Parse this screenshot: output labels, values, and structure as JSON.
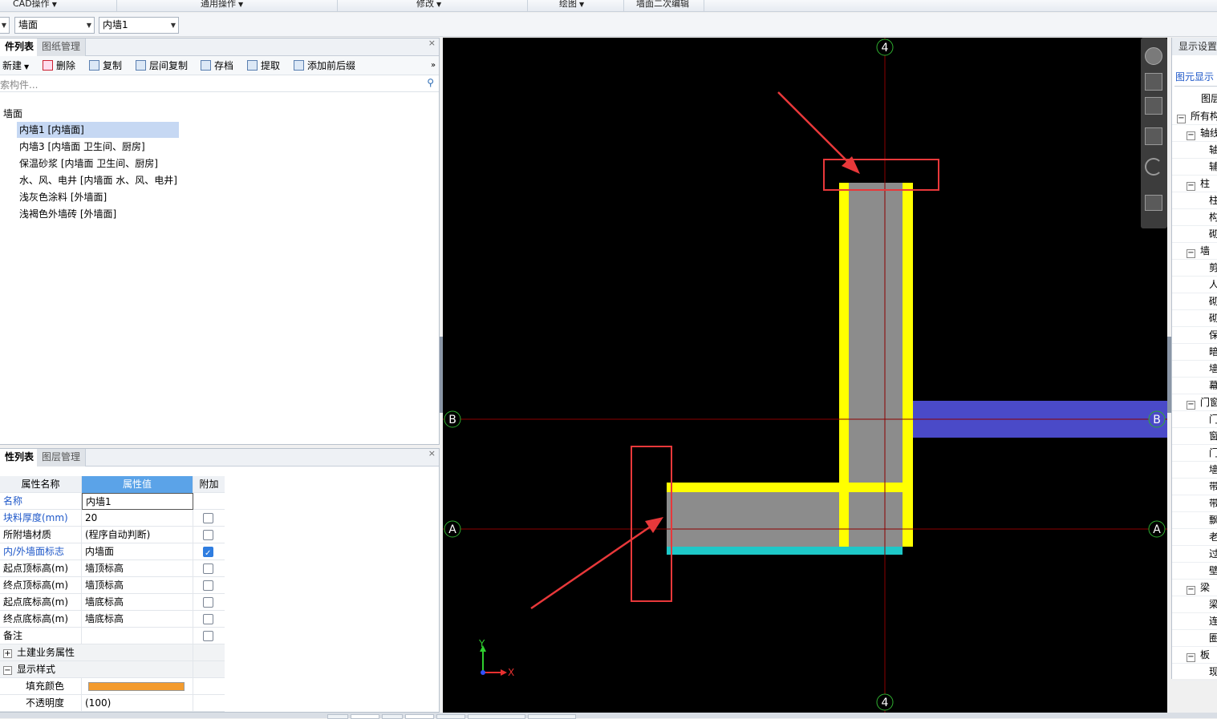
{
  "menubar": {
    "items": [
      {
        "label": "CAD操作",
        "caret": true
      },
      {
        "label": "通用操作",
        "caret": true
      },
      {
        "label": "修改",
        "caret": true
      },
      {
        "label": "绘图",
        "caret": true
      },
      {
        "label": "墙面二次编辑",
        "caret": false
      }
    ]
  },
  "toolbar": {
    "type_combo": "墙面",
    "component_combo": "内墙1"
  },
  "component_panel": {
    "tabs": [
      "件列表",
      "图纸管理"
    ],
    "close": "×",
    "tools": {
      "new": "新建",
      "delete": "删除",
      "copy": "复制",
      "floor_copy": "层间复制",
      "archive": "存档",
      "extract": "提取",
      "add_affix": "添加前后缀",
      "more": "»"
    },
    "search_placeholder": "索构件...",
    "tree_root": "墙面",
    "tree_items": [
      "内墙1 [内墙面]",
      "内墙3 [内墙面 卫生间、厨房]",
      "保温砂浆 [内墙面 卫生间、厨房]",
      "水、风、电井 [内墙面 水、风、电井]",
      "浅灰色涂料 [外墙面]",
      "浅褐色外墙砖 [外墙面]"
    ]
  },
  "property_panel": {
    "tabs": [
      "性列表",
      "图层管理"
    ],
    "close": "×",
    "headers": [
      "属性名称",
      "属性值",
      "附加"
    ],
    "rows": [
      {
        "name": "名称",
        "value": "内墙1",
        "blue": true,
        "check": null
      },
      {
        "name": "块料厚度(mm)",
        "value": "20",
        "blue": true,
        "check": false
      },
      {
        "name": "所附墙材质",
        "value": "(程序自动判断)",
        "blue": false,
        "check": false
      },
      {
        "name": "内/外墙面标志",
        "value": "内墙面",
        "blue": true,
        "check": true
      },
      {
        "name": "起点顶标高(m)",
        "value": "墙顶标高",
        "blue": false,
        "check": false
      },
      {
        "name": "终点顶标高(m)",
        "value": "墙顶标高",
        "blue": false,
        "check": false
      },
      {
        "name": "起点底标高(m)",
        "value": "墙底标高",
        "blue": false,
        "check": false
      },
      {
        "name": "终点底标高(m)",
        "value": "墙底标高",
        "blue": false,
        "check": false
      },
      {
        "name": "备注",
        "value": "",
        "blue": false,
        "check": false
      }
    ],
    "groups": {
      "civil": "土建业务属性",
      "display": "显示样式",
      "fill_color_label": "填充颜色",
      "opacity_label": "不透明度",
      "opacity_value": "(100)"
    },
    "fill_color": "#f39b2e"
  },
  "canvas": {
    "axis_labels": {
      "top": "4",
      "bottom": "4",
      "left_b": "B",
      "right_b": "B",
      "left_a": "A",
      "right_a": "A"
    },
    "ucs": {
      "x": "X",
      "y": "Y"
    },
    "colors": {
      "wall_face": "#ffff00",
      "wall_fill": "#8c8c8c",
      "cyan": "#1ec8c8",
      "blue_wall": "#4a4ac8",
      "annotation": "#e8383a",
      "axis": "#8b0000"
    }
  },
  "right_panel": {
    "title": "显示设置",
    "tab": "图元显示",
    "header": "图层",
    "items": [
      {
        "label": "所有构",
        "box": "−",
        "level": 0
      },
      {
        "label": "轴线",
        "box": "−",
        "level": 1
      },
      {
        "label": "轴",
        "box": "",
        "level": 2
      },
      {
        "label": "辅",
        "box": "",
        "level": 2
      },
      {
        "label": "柱",
        "box": "−",
        "level": 1
      },
      {
        "label": "柱",
        "box": "",
        "level": 2
      },
      {
        "label": "构",
        "box": "",
        "level": 2
      },
      {
        "label": "砌",
        "box": "",
        "level": 2
      },
      {
        "label": "墙",
        "box": "−",
        "level": 1
      },
      {
        "label": "剪",
        "box": "",
        "level": 2
      },
      {
        "label": "人",
        "box": "",
        "level": 2
      },
      {
        "label": "砌",
        "box": "",
        "level": 2
      },
      {
        "label": "砌",
        "box": "",
        "level": 2
      },
      {
        "label": "保",
        "box": "",
        "level": 2
      },
      {
        "label": "暗",
        "box": "",
        "level": 2
      },
      {
        "label": "墙",
        "box": "",
        "level": 2
      },
      {
        "label": "幕",
        "box": "",
        "level": 2
      },
      {
        "label": "门窗",
        "box": "−",
        "level": 1
      },
      {
        "label": "门",
        "box": "",
        "level": 2
      },
      {
        "label": "窗",
        "box": "",
        "level": 2
      },
      {
        "label": "门",
        "box": "",
        "level": 2
      },
      {
        "label": "墙",
        "box": "",
        "level": 2
      },
      {
        "label": "带",
        "box": "",
        "level": 2
      },
      {
        "label": "带",
        "box": "",
        "level": 2
      },
      {
        "label": "飘",
        "box": "",
        "level": 2
      },
      {
        "label": "老",
        "box": "",
        "level": 2
      },
      {
        "label": "过",
        "box": "",
        "level": 2
      },
      {
        "label": "壁",
        "box": "",
        "level": 2
      },
      {
        "label": "梁",
        "box": "−",
        "level": 1
      },
      {
        "label": "梁",
        "box": "",
        "level": 2
      },
      {
        "label": "连",
        "box": "",
        "level": 2
      },
      {
        "label": "圈",
        "box": "",
        "level": 2
      },
      {
        "label": "板",
        "box": "−",
        "level": 1
      },
      {
        "label": "现",
        "box": "",
        "level": 2
      }
    ]
  }
}
